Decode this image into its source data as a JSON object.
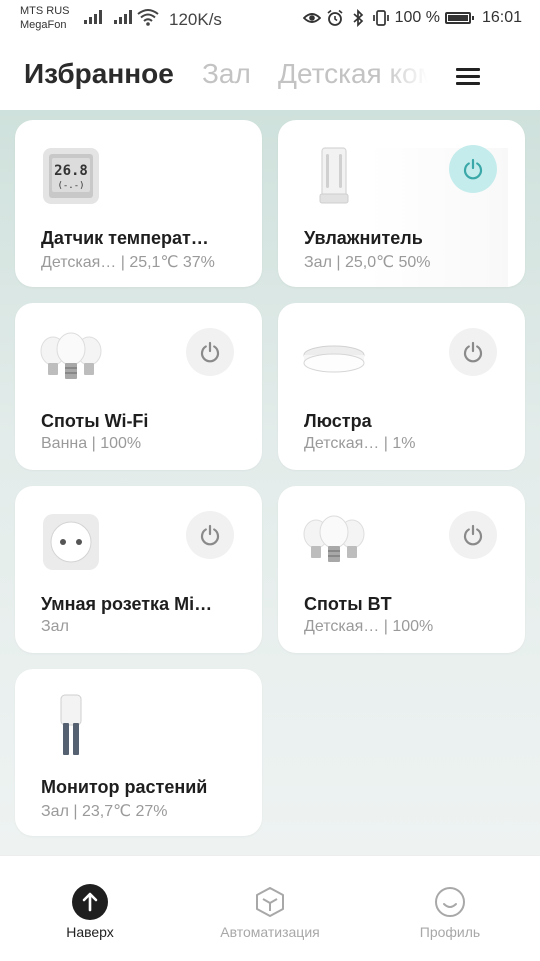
{
  "status_bar": {
    "carrier_1": "MTS RUS",
    "carrier_2": "MegaFon",
    "net_speed": "120K/s",
    "battery": "100 %",
    "time": "16:01"
  },
  "header": {
    "tabs": [
      {
        "label": "Избранное",
        "active": true
      },
      {
        "label": "Зал",
        "active": false
      },
      {
        "label": "Детская комната",
        "active": false
      }
    ],
    "menu_icon": "hamburger-menu-icon"
  },
  "devices": [
    {
      "name": "Датчик температ…",
      "sub": "Детская…   | 25,1℃ 37%",
      "has_power": false,
      "icon": "temperature-sensor-icon",
      "display": {
        "line1": "26.8",
        "line2": "(-.-)"
      }
    },
    {
      "name": "Увлажнитель",
      "sub": "Зал | 25,0℃ 50%",
      "has_power": true,
      "power_on": true,
      "icon": "humidifier-icon"
    },
    {
      "name": "Споты Wi-Fi",
      "sub": "Ванна | 100%",
      "has_power": true,
      "power_on": false,
      "icon": "bulbs-icon"
    },
    {
      "name": "Люстра",
      "sub": "Детская…   | 1%",
      "has_power": true,
      "power_on": false,
      "icon": "ceiling-lamp-icon"
    },
    {
      "name": "Умная розетка Mi…",
      "sub": "Зал",
      "has_power": true,
      "power_on": false,
      "icon": "smart-socket-icon"
    },
    {
      "name": "Споты BT",
      "sub": "Детская…   | 100%",
      "has_power": true,
      "power_on": false,
      "icon": "bulbs-icon"
    },
    {
      "name": "Монитор растений",
      "sub": "Зал | 23,7℃ 27%",
      "has_power": false,
      "icon": "plant-monitor-icon"
    }
  ],
  "bottom_nav": [
    {
      "label": "Наверх",
      "icon": "arrow-up-icon",
      "active": true
    },
    {
      "label": "Автоматизация",
      "icon": "automation-cube-icon",
      "active": false
    },
    {
      "label": "Профиль",
      "icon": "profile-smile-icon",
      "active": false
    }
  ],
  "colors": {
    "accent": "#4bb5b5",
    "power_on_bg": "#c5ecec",
    "background_top": "#cfe1dc"
  }
}
